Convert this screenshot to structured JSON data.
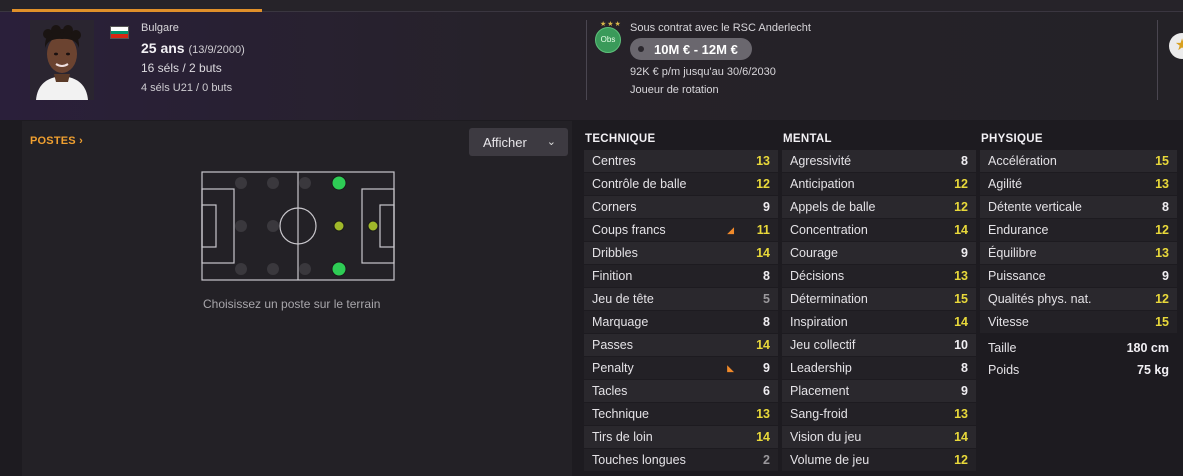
{
  "player": {
    "nationality": "Bulgare",
    "age": "25 ans",
    "dob": "(13/9/2000)",
    "caps": "16 séls / 2 buts",
    "u21_caps": "4 séls U21 / 0 buts",
    "flag_colors": [
      "#ffffff",
      "#00966e",
      "#d62612"
    ]
  },
  "contract": {
    "club_badge": "Obs",
    "club_stars": "★★★",
    "status": "Sous contrat avec le RSC Anderlecht",
    "value": "10M € - 12M €",
    "wage": "92K € p/m jusqu'au 30/6/2030",
    "role": "Joueur de rotation",
    "fav_icon": "★"
  },
  "positions": {
    "title": "POSTES",
    "chevron": "›",
    "display_button": "Afficher",
    "display_chevron": "⌄",
    "hint": "Choisissez un poste sur le terrain"
  },
  "technique": {
    "title": "TECHNIQUE",
    "items": [
      {
        "label": "Centres",
        "value": "13"
      },
      {
        "label": "Contrôle de balle",
        "value": "12"
      },
      {
        "label": "Corners",
        "value": "9"
      },
      {
        "label": "Coups francs",
        "value": "11",
        "arrow": "up"
      },
      {
        "label": "Dribbles",
        "value": "14"
      },
      {
        "label": "Finition",
        "value": "8"
      },
      {
        "label": "Jeu de tête",
        "value": "5"
      },
      {
        "label": "Marquage",
        "value": "8"
      },
      {
        "label": "Passes",
        "value": "14"
      },
      {
        "label": "Penalty",
        "value": "9",
        "arrow": "down"
      },
      {
        "label": "Tacles",
        "value": "6"
      },
      {
        "label": "Technique",
        "value": "13"
      },
      {
        "label": "Tirs de loin",
        "value": "14"
      },
      {
        "label": "Touches longues",
        "value": "2"
      }
    ]
  },
  "mental": {
    "title": "MENTAL",
    "items": [
      {
        "label": "Agressivité",
        "value": "8"
      },
      {
        "label": "Anticipation",
        "value": "12"
      },
      {
        "label": "Appels de balle",
        "value": "12"
      },
      {
        "label": "Concentration",
        "value": "14"
      },
      {
        "label": "Courage",
        "value": "9"
      },
      {
        "label": "Décisions",
        "value": "13"
      },
      {
        "label": "Détermination",
        "value": "15"
      },
      {
        "label": "Inspiration",
        "value": "14"
      },
      {
        "label": "Jeu collectif",
        "value": "10"
      },
      {
        "label": "Leadership",
        "value": "8"
      },
      {
        "label": "Placement",
        "value": "9"
      },
      {
        "label": "Sang-froid",
        "value": "13"
      },
      {
        "label": "Vision du jeu",
        "value": "14"
      },
      {
        "label": "Volume de jeu",
        "value": "12"
      }
    ]
  },
  "physique": {
    "title": "PHYSIQUE",
    "items": [
      {
        "label": "Accélération",
        "value": "15"
      },
      {
        "label": "Agilité",
        "value": "13"
      },
      {
        "label": "Détente verticale",
        "value": "8"
      },
      {
        "label": "Endurance",
        "value": "12"
      },
      {
        "label": "Équilibre",
        "value": "13"
      },
      {
        "label": "Puissance",
        "value": "9"
      },
      {
        "label": "Qualités phys. nat.",
        "value": "12"
      },
      {
        "label": "Vitesse",
        "value": "15"
      }
    ],
    "height_label": "Taille",
    "height_value": "180 cm",
    "weight_label": "Poids",
    "weight_value": "75 kg"
  },
  "colors": {
    "accent": "#e0902a",
    "high_value": "#e8d83a",
    "pos_natural": "#2ecc55",
    "pos_accomplished": "#a0b82a"
  }
}
